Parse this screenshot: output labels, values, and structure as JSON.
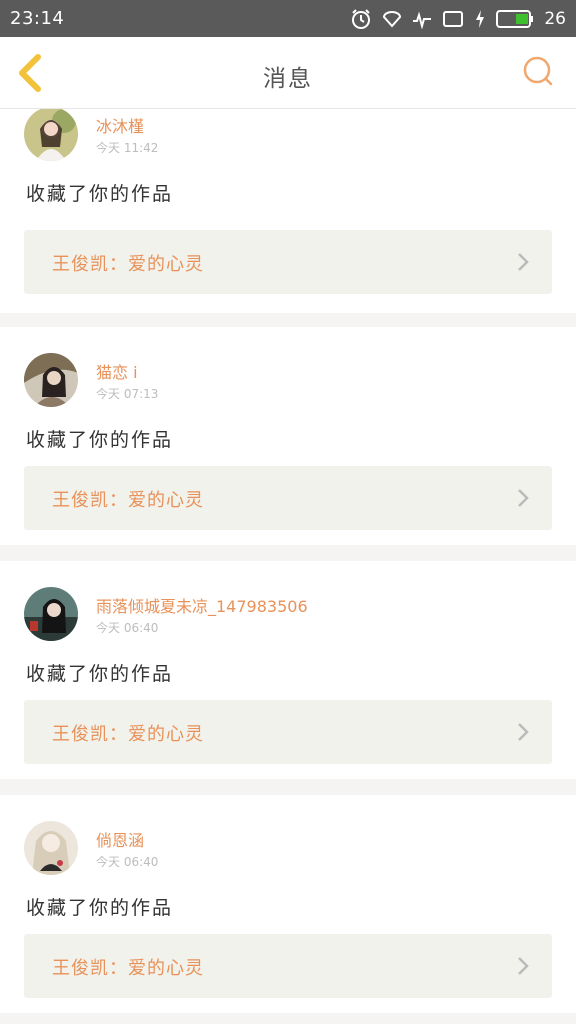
{
  "status_bar": {
    "time": "23:14",
    "battery": "26",
    "icons": [
      "alarm-icon",
      "wifi-icon",
      "signal-icon",
      "sim-icon",
      "charging-icon",
      "battery-icon"
    ]
  },
  "header": {
    "title": "消息",
    "back_icon": "chevron-left-icon",
    "search_icon": "search-icon"
  },
  "colors": {
    "accent": "#e8925a",
    "back_arrow": "#f2c23a",
    "status_bar_bg": "#5a5a5a",
    "work_box_bg": "#f2f2ec"
  },
  "messages": [
    {
      "user": "冰沐槿",
      "time": "今天 11:42",
      "action": "收藏了你的作品",
      "work": "王俊凯：爱的心灵"
    },
    {
      "user": "猫恋 i",
      "time": "今天 07:13",
      "action": "收藏了你的作品",
      "work": "王俊凯：爱的心灵"
    },
    {
      "user": "雨落倾城夏未凉_147983506",
      "time": "今天 06:40",
      "action": "收藏了你的作品",
      "work": "王俊凯：爱的心灵"
    },
    {
      "user": "倘恩涵",
      "time": "今天 06:40",
      "action": "收藏了你的作品",
      "work": "王俊凯：爱的心灵"
    }
  ]
}
